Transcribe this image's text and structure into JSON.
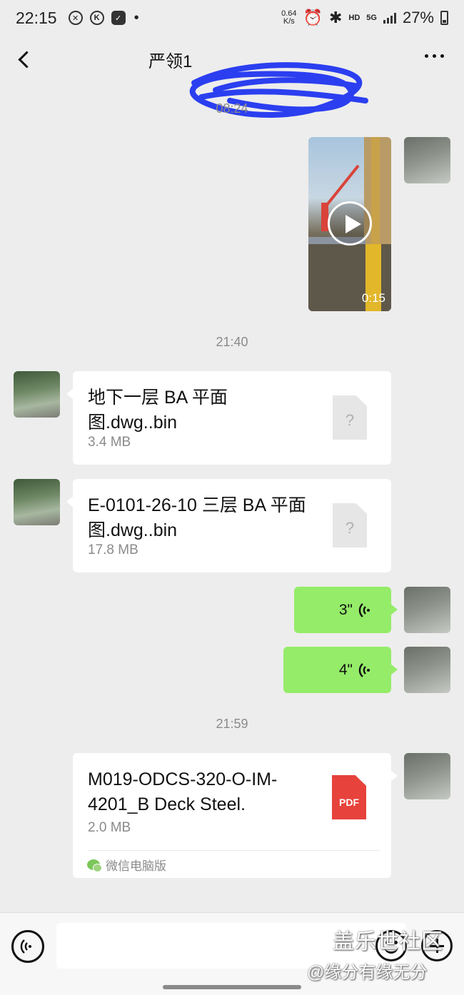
{
  "status_bar": {
    "time": "22:15",
    "net_speed": "0.64",
    "net_unit": "K/s",
    "hd": "HD",
    "network": "5G",
    "battery": "27%"
  },
  "header": {
    "title": "严领1"
  },
  "messages": {
    "time1": "08:24",
    "video_duration": "0:15",
    "time2": "21:40",
    "file1": {
      "name": "地下一层 BA 平面图.dwg..bin",
      "size": "3.4 MB",
      "icon": "?"
    },
    "file2": {
      "name": "E-0101-26-10  三层 BA 平面图.dwg..bin",
      "size": "17.8 MB",
      "icon": "?"
    },
    "voice1": {
      "duration": "3\""
    },
    "voice2": {
      "duration": "4\""
    },
    "time3": "21:59",
    "file3": {
      "name": "M019-ODCS-320-O-IM-4201_B Deck Steel.",
      "size": "2.0 MB",
      "icon": "PDF",
      "source": "微信电脑版"
    }
  },
  "watermark": {
    "line1": "盖乐世社区",
    "line2": "@缘分有缘无分"
  },
  "colors": {
    "background": "#ededed",
    "sent_bubble": "#95ec69",
    "pdf_red": "#e7423c",
    "time_label": "#8a8a8a"
  }
}
